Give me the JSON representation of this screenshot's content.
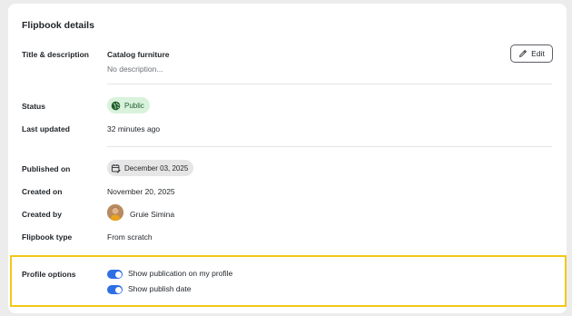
{
  "card": {
    "title": "Flipbook details"
  },
  "title_description": {
    "label": "Title & description",
    "title": "Catalog furniture",
    "description": "No description..."
  },
  "edit_button": {
    "label": "Edit",
    "icon": "pencil-icon"
  },
  "status": {
    "label": "Status",
    "value": "Public",
    "icon": "globe-icon",
    "color": "#d9f2dc"
  },
  "last_updated": {
    "label": "Last updated",
    "value": "32 minutes ago"
  },
  "published_on": {
    "label": "Published on",
    "value": "December 03, 2025",
    "icon": "calendar-edit-icon"
  },
  "created_on": {
    "label": "Created on",
    "value": "November 20, 2025"
  },
  "created_by": {
    "label": "Created by",
    "value": "Gruie Simina",
    "icon": "avatar"
  },
  "flipbook_type": {
    "label": "Flipbook type",
    "value": "From scratch"
  },
  "profile_options": {
    "label": "Profile options",
    "options": [
      {
        "label": "Show publication on my profile",
        "enabled": true
      },
      {
        "label": "Show publish date",
        "enabled": true
      }
    ],
    "highlight_color": "#f2c81a",
    "toggle_color": "#2f6fe4"
  }
}
